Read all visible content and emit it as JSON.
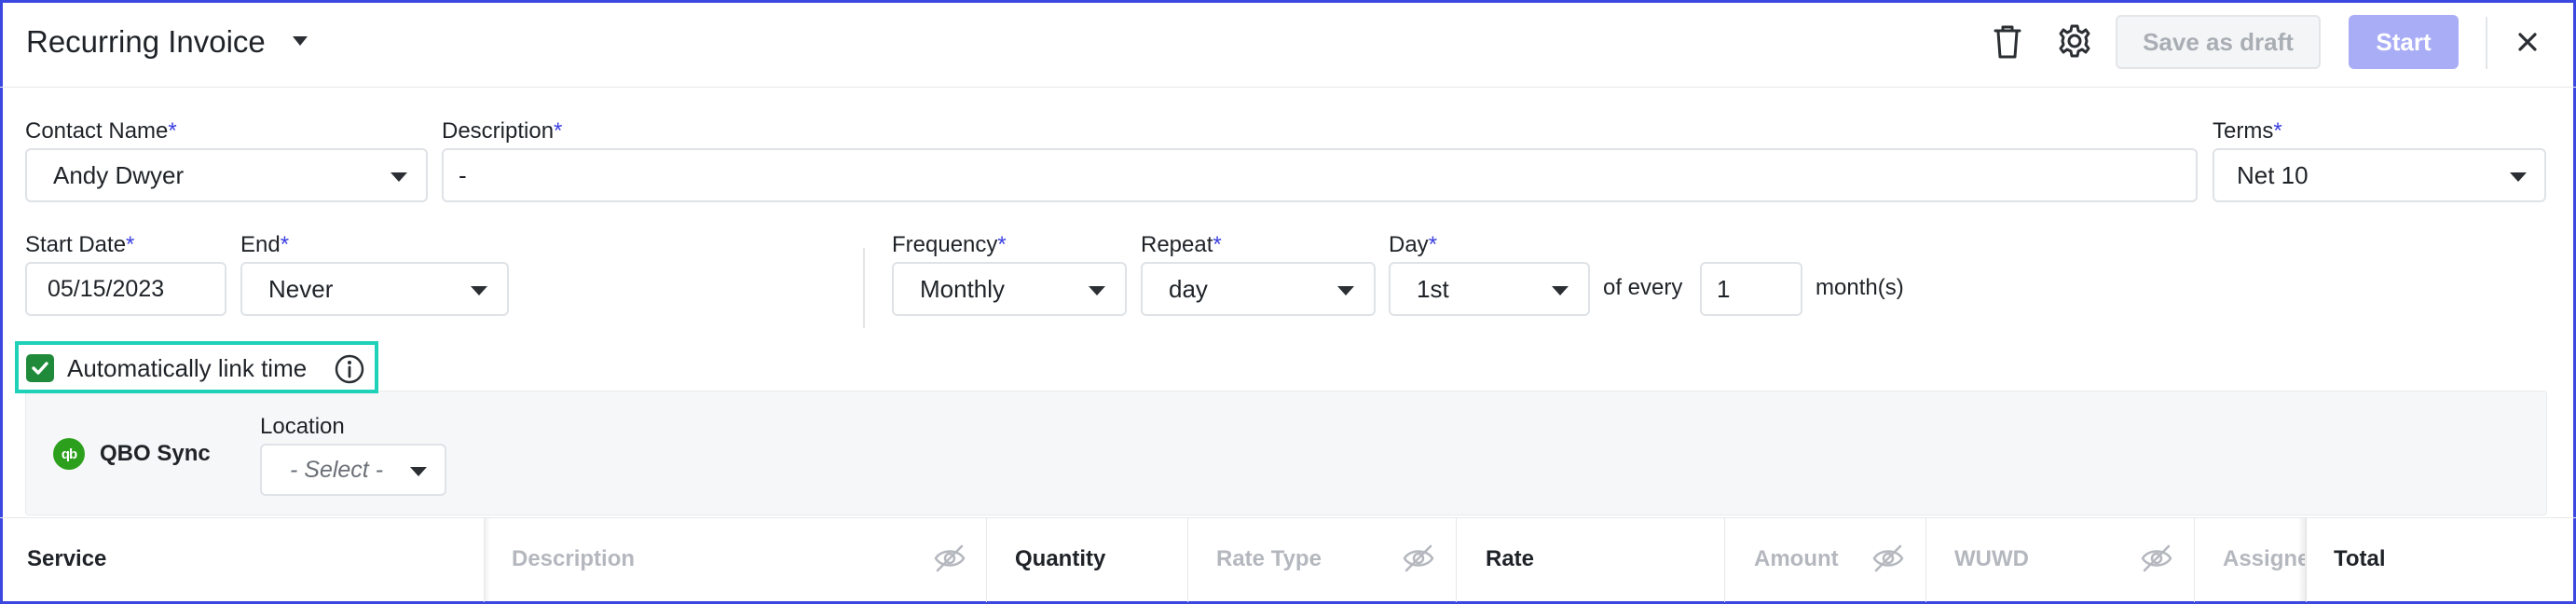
{
  "header": {
    "title": "Recurring Invoice",
    "save_draft_label": "Save as draft",
    "start_label": "Start"
  },
  "form": {
    "contact_name": {
      "label": "Contact Name",
      "required": "*",
      "value": "Andy Dwyer"
    },
    "description": {
      "label": "Description",
      "required": "*",
      "value": "-"
    },
    "terms": {
      "label": "Terms",
      "required": "*",
      "value": "Net 10"
    },
    "start_date": {
      "label": "Start Date",
      "required": "*",
      "value": "05/15/2023"
    },
    "end": {
      "label": "End",
      "required": "*",
      "value": "Never"
    },
    "frequency": {
      "label": "Frequency",
      "required": "*",
      "value": "Monthly"
    },
    "repeat": {
      "label": "Repeat",
      "required": "*",
      "value": "day"
    },
    "day": {
      "label": "Day",
      "required": "*",
      "value": "1st"
    },
    "of_every_label": "of every",
    "interval": "1",
    "interval_unit": "month(s)",
    "auto_link_time": {
      "label": "Automatically link time",
      "checked": true
    }
  },
  "qbo": {
    "title": "QBO Sync",
    "logo_text": "qb",
    "location": {
      "label": "Location",
      "placeholder": "- Select -"
    }
  },
  "table": {
    "columns": [
      "Service",
      "Description",
      "Quantity",
      "Rate Type",
      "Rate",
      "Amount",
      "WUWD",
      "Assignee",
      "Total"
    ]
  },
  "colors": {
    "accent": "#3b48e0",
    "start_button": "#a9adf5",
    "highlight": "#1ed1b8",
    "checkbox": "#1f8a3a",
    "qbo": "#2ca01c"
  }
}
